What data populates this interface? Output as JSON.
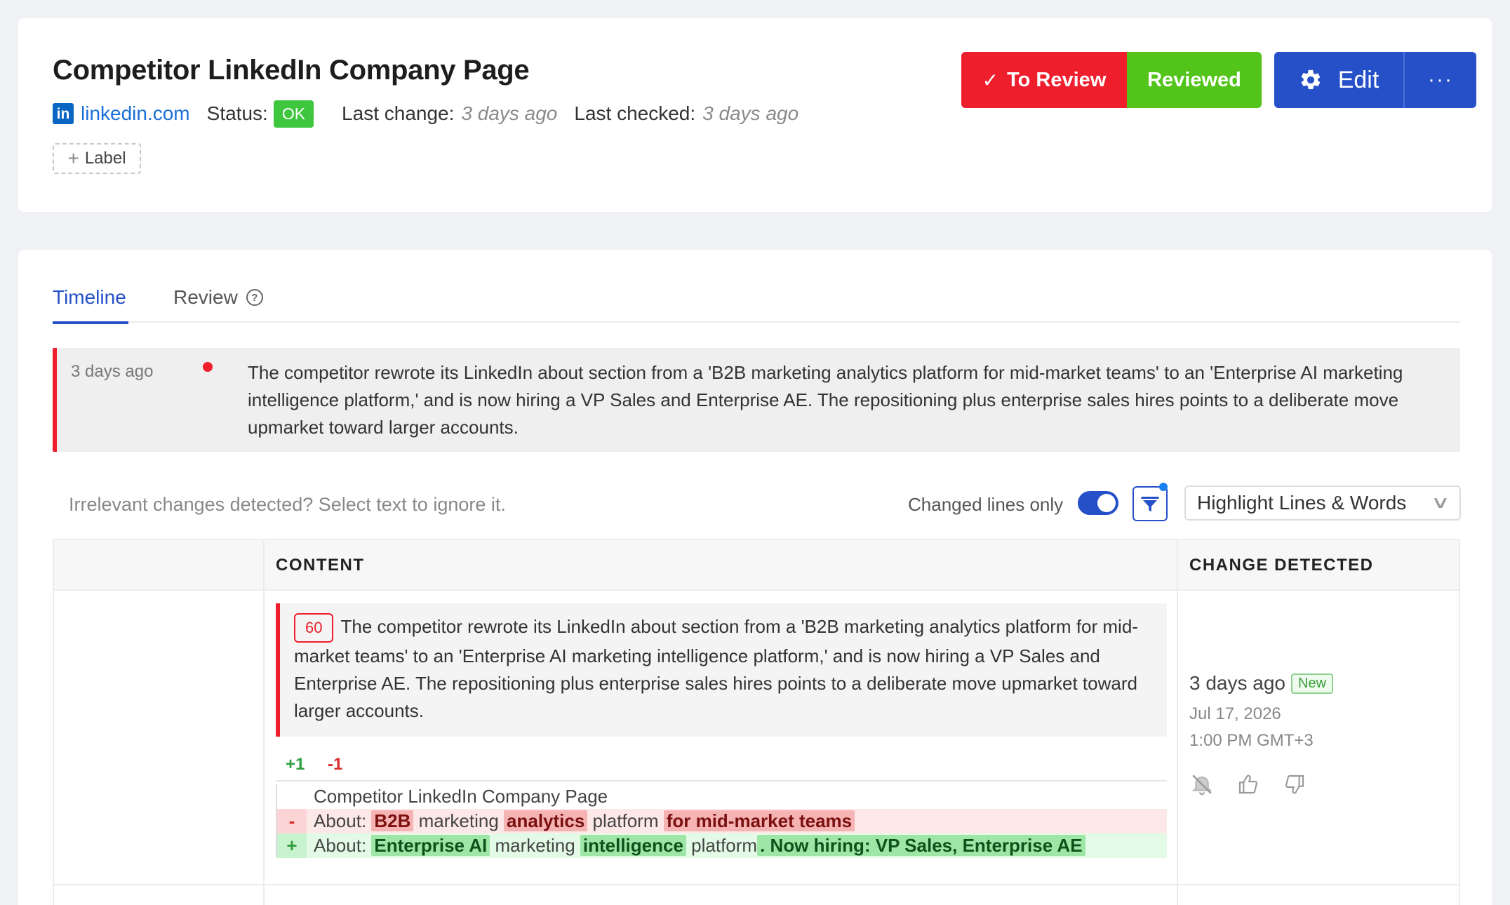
{
  "header": {
    "title": "Competitor LinkedIn Company Page",
    "site_icon": "in",
    "site": "linkedin.com",
    "status_label": "Status:",
    "status_value": "OK",
    "last_change_label": "Last change:",
    "last_change_value": "3 days ago",
    "last_checked_label": "Last checked:",
    "last_checked_value": "3 days ago",
    "label_button": "Label",
    "to_review_button": "To Review",
    "reviewed_button": "Reviewed",
    "edit_button": "Edit",
    "more_button": "···"
  },
  "tabs": {
    "timeline": "Timeline",
    "review": "Review"
  },
  "summary": {
    "time": "3 days ago",
    "text": "The competitor rewrote its LinkedIn about section from a 'B2B marketing analytics platform for mid-market teams' to an 'Enterprise AI marketing intelligence platform,' and is now hiring a VP Sales and Enterprise AE. The repositioning plus enterprise sales hires points to a deliberate move upmarket toward larger accounts."
  },
  "toolbar": {
    "hint": "Irrelevant changes detected? Select text to ignore it.",
    "changed_lines_label": "Changed lines only",
    "changed_lines_on": true,
    "highlight_select": "Highlight Lines & Words"
  },
  "table": {
    "col_content": "CONTENT",
    "col_change": "CHANGE DETECTED"
  },
  "row": {
    "score": "60",
    "insight": "The competitor rewrote its LinkedIn about section from a 'B2B marketing analytics platform for mid-market teams' to an 'Enterprise AI marketing intelligence platform,' and is now hiring a VP Sales and Enterprise AE. The repositioning plus enterprise sales hires points to a deliberate move upmarket toward larger accounts.",
    "added_count": "+1",
    "removed_count": "-1",
    "diff": {
      "context": "Competitor LinkedIn Company Page",
      "del_marker": "-",
      "add_marker": "+",
      "del": [
        {
          "t": "About: ",
          "h": false
        },
        {
          "t": "B2B",
          "h": true
        },
        {
          "t": " marketing ",
          "h": false
        },
        {
          "t": "analytics",
          "h": true
        },
        {
          "t": " platform ",
          "h": false
        },
        {
          "t": "for mid-market teams",
          "h": true
        }
      ],
      "add": [
        {
          "t": "About: ",
          "h": false
        },
        {
          "t": "Enterprise AI",
          "h": true
        },
        {
          "t": " marketing ",
          "h": false
        },
        {
          "t": "intelligence",
          "h": true
        },
        {
          "t": " platform",
          "h": false
        },
        {
          "t": ". Now hiring: VP Sales, Enterprise AE",
          "h": true
        }
      ]
    },
    "change_ago": "3 days ago",
    "new_badge": "New",
    "change_date": "Jul 17, 2026",
    "change_time": "1:00 PM GMT+3"
  },
  "colors": {
    "accent": "#2550c8",
    "danger": "#ee1e2d",
    "success": "#52c41a"
  },
  "icons": [
    "linkedin-icon",
    "check-icon",
    "gear-icon",
    "more-icon",
    "plus-icon",
    "help-icon",
    "filter-icon",
    "chevron-down-icon",
    "mute-bell-icon",
    "thumbs-up-icon",
    "thumbs-down-icon"
  ]
}
